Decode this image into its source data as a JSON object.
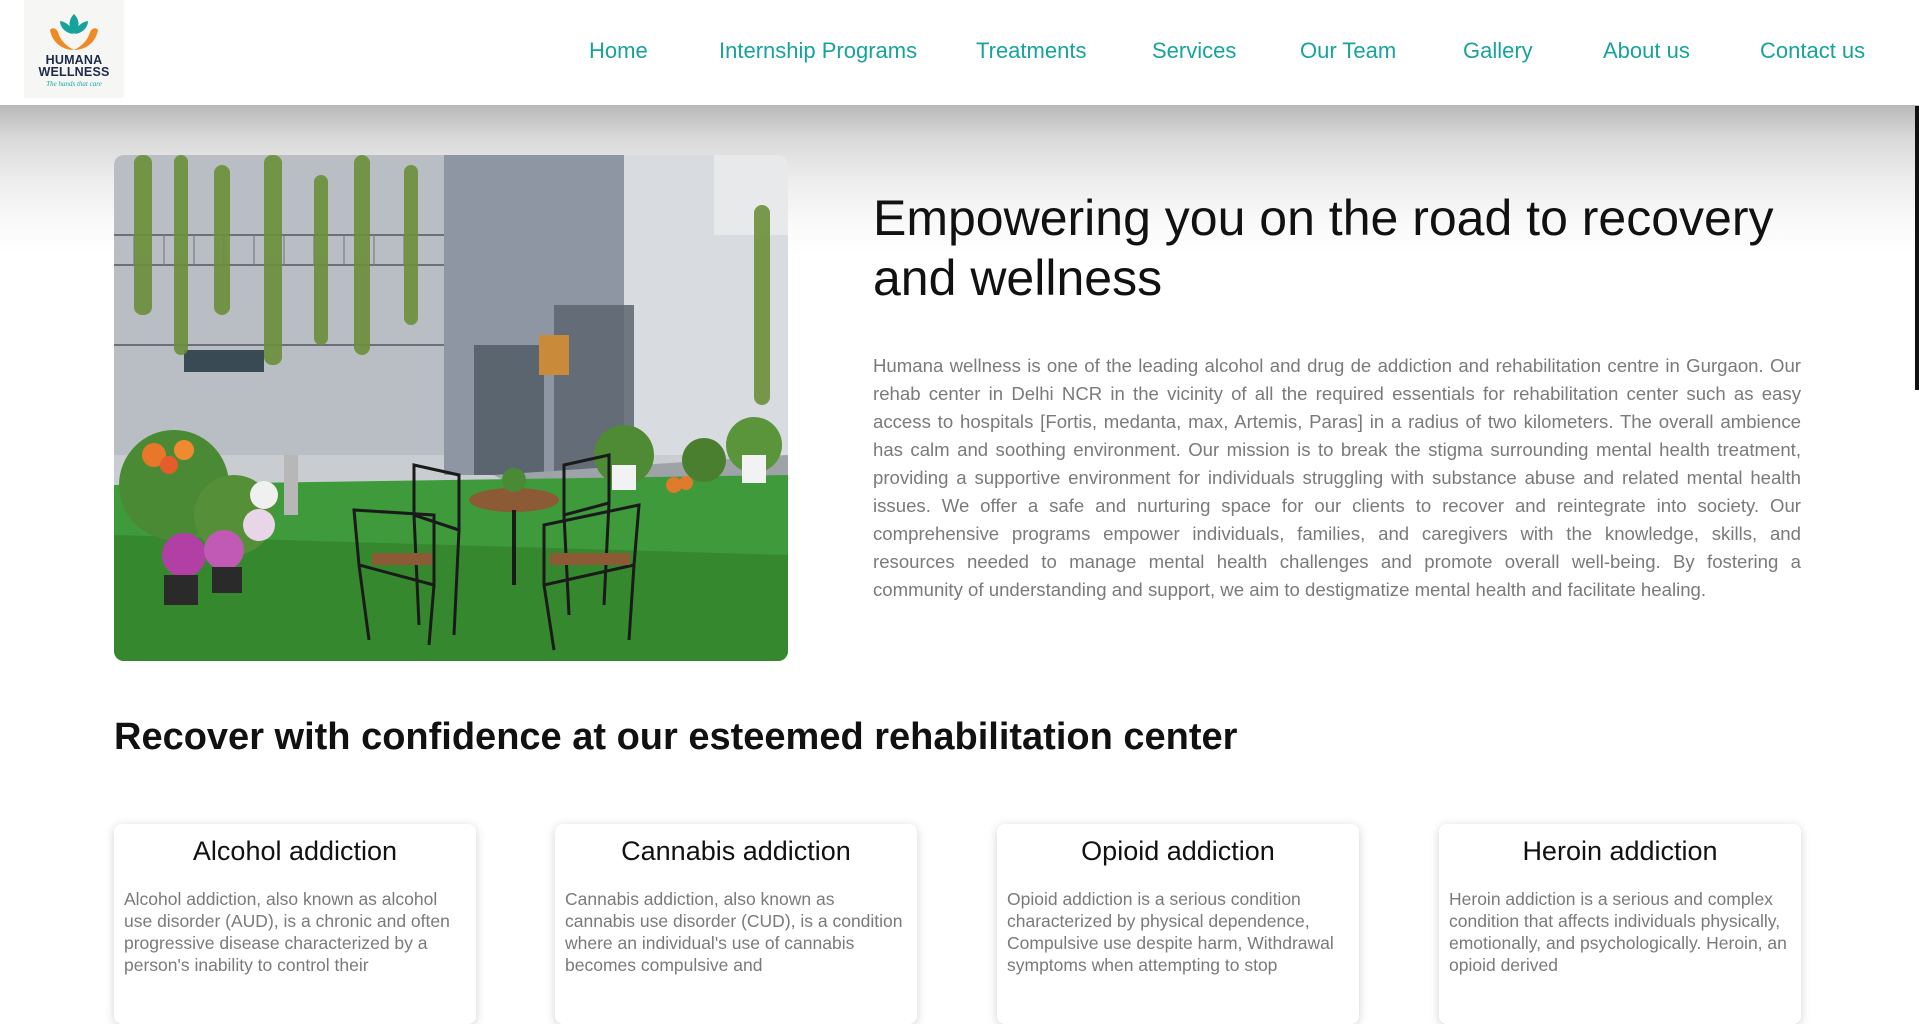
{
  "brand": {
    "name_line1": "HUMANA",
    "name_line2": "WELLNESS",
    "tagline": "The hands that care",
    "colors": {
      "teal": "#17a39c",
      "orange": "#f08a24",
      "navy": "#1c2b4a"
    }
  },
  "nav": {
    "items": [
      {
        "label": "Home"
      },
      {
        "label": "Internship Programs"
      },
      {
        "label": "Treatments"
      },
      {
        "label": "Services"
      },
      {
        "label": "Our Team"
      },
      {
        "label": "Gallery"
      },
      {
        "label": "About us"
      },
      {
        "label": "Contact us"
      }
    ]
  },
  "hero": {
    "title": "Empowering you on the road to recovery and wellness",
    "body": "Humana wellness is one of the leading alcohol and drug de addiction and rehabilitation centre in Gurgaon. Our rehab center in Delhi NCR in the vicinity of all the required essentials for rehabilitation center such as easy access to hospitals [Fortis, medanta, max, Artemis, Paras] in a radius of two kilometers. The overall ambience has calm and soothing environment. Our mission is to break the stigma surrounding mental health treatment, providing a supportive environment for individuals struggling with substance abuse and related mental health issues. We offer a safe and nurturing space for our clients to recover and reintegrate into society. Our comprehensive programs empower individuals, families, and caregivers with the knowledge, skills, and resources needed to manage mental health challenges and promote overall well-being. By fostering a community of understanding and support, we aim to destigmatize mental health and facilitate healing."
  },
  "section": {
    "title": "Recover with confidence at our esteemed rehabilitation center"
  },
  "cards": [
    {
      "title": "Alcohol addiction",
      "text": "Alcohol addiction, also known as alcohol use disorder (AUD), is a chronic and often progressive disease characterized by a person's inability to control their"
    },
    {
      "title": "Cannabis addiction",
      "text": "Cannabis addiction, also known as cannabis use disorder (CUD), is a condition where an individual's use of cannabis becomes compulsive and"
    },
    {
      "title": "Opioid addiction",
      "text": "Opioid addiction is a serious condition characterized by physical dependence, Compulsive use despite harm, Withdrawal symptoms when attempting to stop"
    },
    {
      "title": "Heroin addiction",
      "text": "Heroin addiction is a serious and complex condition that affects individuals physically, emotionally, and psychologically. Heroin, an opioid derived"
    }
  ]
}
